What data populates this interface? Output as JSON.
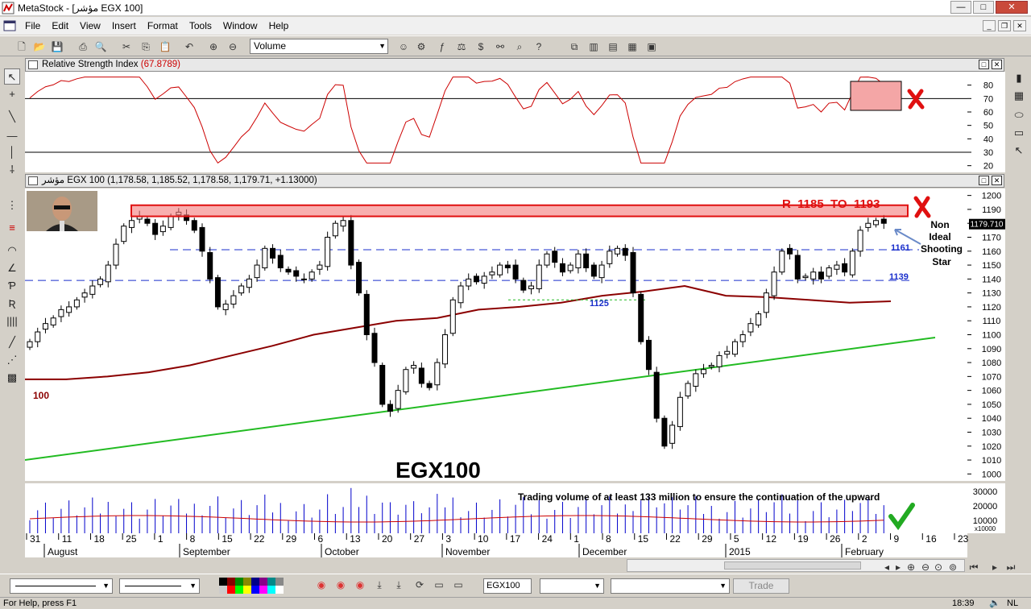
{
  "window": {
    "title": "MetaStock - [مؤشر EGX 100]",
    "min": "—",
    "max": "□",
    "close": "✕"
  },
  "menu": [
    "File",
    "Edit",
    "View",
    "Insert",
    "Format",
    "Tools",
    "Window",
    "Help"
  ],
  "toolbar": {
    "indicator_select": "Volume"
  },
  "rsi_pane": {
    "title": "Relative Strength Index",
    "value": "(67.8789)",
    "y_ticks": [
      "80",
      "70",
      "60",
      "50",
      "40",
      "30",
      "20"
    ],
    "upper_line": 70,
    "lower_line": 30
  },
  "price_pane": {
    "header": "مؤشر EGX 100 (1,178.58, 1,185.52, 1,178.58, 1,179.71, +1.13000)",
    "y_ticks": [
      "1200",
      "1190",
      "1180",
      "1170",
      "1160",
      "1150",
      "1140",
      "1130",
      "1120",
      "1110",
      "1100",
      "1090",
      "1080",
      "1070",
      "1060",
      "1050",
      "1040",
      "1030",
      "1020",
      "1010",
      "1000"
    ],
    "last_price": "1179.710",
    "resistance_label": "R  1185  TO  1193",
    "level_1161": "1161",
    "level_1139": "1139",
    "level_1125": "1125",
    "ma_label": "100",
    "chart_title": "EGX100",
    "annotation_star": [
      "Non",
      "Ideal",
      "Shooting",
      "Star"
    ]
  },
  "volume_pane": {
    "y_ticks": [
      "30000",
      "20000",
      "10000"
    ],
    "scale_note": "x10000",
    "note": "Trading volume of at least 133 million to ensure the continuation of the upward"
  },
  "x_axis": {
    "days": [
      "31",
      "11",
      "18",
      "25",
      "1",
      "8",
      "15",
      "22",
      "29",
      "6",
      "13",
      "20",
      "27",
      "3",
      "10",
      "17",
      "24",
      "1",
      "8",
      "15",
      "22",
      "29",
      "5",
      "12",
      "19",
      "26",
      "2",
      "9",
      "16",
      "23"
    ],
    "months": [
      "August",
      "September",
      "October",
      "November",
      "December",
      "2015",
      "February"
    ]
  },
  "bottombar": {
    "symbol": "EGX100",
    "trade": "Trade"
  },
  "status": {
    "help": "For Help, press F1",
    "time": "18:39",
    "lang": "NL"
  },
  "colors": {
    "rsi": "#cc0000",
    "ma": "#8b0000",
    "trendline": "#22bb22",
    "resistance_box": "#ff8080",
    "volume": "#0000cc",
    "level_text": "#1a2fcc",
    "mark": "#e01010"
  },
  "chart_data": {
    "type": "candlestick",
    "title": "EGX100",
    "ylim": [
      1000,
      1200
    ],
    "levels": [
      1185,
      1193,
      1161,
      1139,
      1125
    ],
    "close_approx": [
      1095,
      1102,
      1108,
      1112,
      1118,
      1120,
      1125,
      1130,
      1135,
      1140,
      1150,
      1165,
      1178,
      1182,
      1185,
      1180,
      1172,
      1178,
      1185,
      1188,
      1182,
      1175,
      1160,
      1140,
      1120,
      1122,
      1128,
      1135,
      1140,
      1150,
      1162,
      1155,
      1148,
      1145,
      1142,
      1140,
      1145,
      1150,
      1170,
      1180,
      1182,
      1150,
      1130,
      1100,
      1080,
      1050,
      1045,
      1060,
      1075,
      1078,
      1065,
      1062,
      1080,
      1100,
      1125,
      1135,
      1140,
      1138,
      1142,
      1145,
      1150,
      1148,
      1140,
      1132,
      1135,
      1150,
      1158,
      1152,
      1145,
      1150,
      1158,
      1148,
      1142,
      1150,
      1160,
      1162,
      1157,
      1130,
      1095,
      1075,
      1040,
      1020,
      1035,
      1055,
      1065,
      1072,
      1075,
      1078,
      1085,
      1088,
      1095,
      1100,
      1108,
      1115,
      1130,
      1145,
      1160,
      1158,
      1140,
      1142,
      1145,
      1140,
      1148,
      1150,
      1145,
      1160,
      1175,
      1180,
      1182,
      1180
    ],
    "sma100_approx": [
      1068,
      1068,
      1070,
      1073,
      1078,
      1085,
      1092,
      1100,
      1105,
      1110,
      1112,
      1118,
      1120,
      1123,
      1128,
      1131,
      1135,
      1128,
      1127,
      1125,
      1123,
      1124
    ]
  }
}
